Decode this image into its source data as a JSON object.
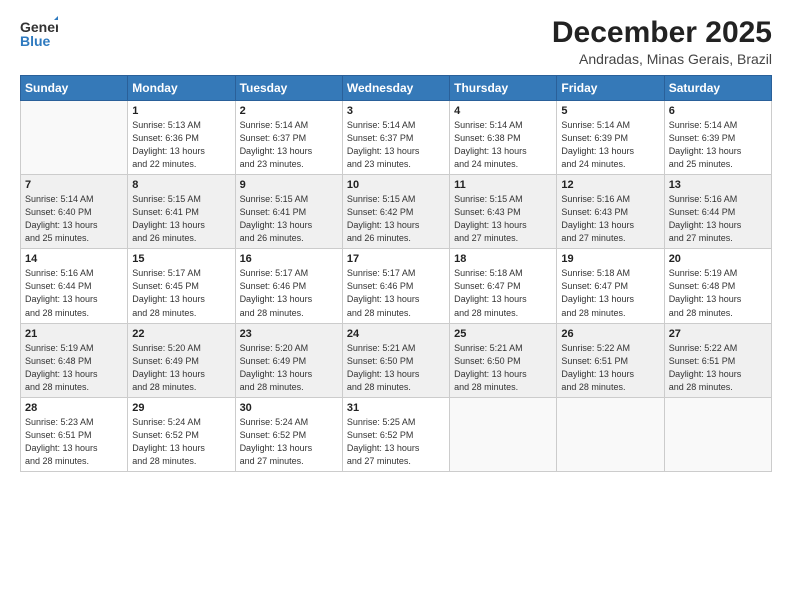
{
  "header": {
    "logo_general": "General",
    "logo_blue": "Blue",
    "month": "December 2025",
    "location": "Andradas, Minas Gerais, Brazil"
  },
  "days_of_week": [
    "Sunday",
    "Monday",
    "Tuesday",
    "Wednesday",
    "Thursday",
    "Friday",
    "Saturday"
  ],
  "weeks": [
    [
      {
        "day": "",
        "info": ""
      },
      {
        "day": "1",
        "info": "Sunrise: 5:13 AM\nSunset: 6:36 PM\nDaylight: 13 hours\nand 22 minutes."
      },
      {
        "day": "2",
        "info": "Sunrise: 5:14 AM\nSunset: 6:37 PM\nDaylight: 13 hours\nand 23 minutes."
      },
      {
        "day": "3",
        "info": "Sunrise: 5:14 AM\nSunset: 6:37 PM\nDaylight: 13 hours\nand 23 minutes."
      },
      {
        "day": "4",
        "info": "Sunrise: 5:14 AM\nSunset: 6:38 PM\nDaylight: 13 hours\nand 24 minutes."
      },
      {
        "day": "5",
        "info": "Sunrise: 5:14 AM\nSunset: 6:39 PM\nDaylight: 13 hours\nand 24 minutes."
      },
      {
        "day": "6",
        "info": "Sunrise: 5:14 AM\nSunset: 6:39 PM\nDaylight: 13 hours\nand 25 minutes."
      }
    ],
    [
      {
        "day": "7",
        "info": "Sunrise: 5:14 AM\nSunset: 6:40 PM\nDaylight: 13 hours\nand 25 minutes."
      },
      {
        "day": "8",
        "info": "Sunrise: 5:15 AM\nSunset: 6:41 PM\nDaylight: 13 hours\nand 26 minutes."
      },
      {
        "day": "9",
        "info": "Sunrise: 5:15 AM\nSunset: 6:41 PM\nDaylight: 13 hours\nand 26 minutes."
      },
      {
        "day": "10",
        "info": "Sunrise: 5:15 AM\nSunset: 6:42 PM\nDaylight: 13 hours\nand 26 minutes."
      },
      {
        "day": "11",
        "info": "Sunrise: 5:15 AM\nSunset: 6:43 PM\nDaylight: 13 hours\nand 27 minutes."
      },
      {
        "day": "12",
        "info": "Sunrise: 5:16 AM\nSunset: 6:43 PM\nDaylight: 13 hours\nand 27 minutes."
      },
      {
        "day": "13",
        "info": "Sunrise: 5:16 AM\nSunset: 6:44 PM\nDaylight: 13 hours\nand 27 minutes."
      }
    ],
    [
      {
        "day": "14",
        "info": "Sunrise: 5:16 AM\nSunset: 6:44 PM\nDaylight: 13 hours\nand 28 minutes."
      },
      {
        "day": "15",
        "info": "Sunrise: 5:17 AM\nSunset: 6:45 PM\nDaylight: 13 hours\nand 28 minutes."
      },
      {
        "day": "16",
        "info": "Sunrise: 5:17 AM\nSunset: 6:46 PM\nDaylight: 13 hours\nand 28 minutes."
      },
      {
        "day": "17",
        "info": "Sunrise: 5:17 AM\nSunset: 6:46 PM\nDaylight: 13 hours\nand 28 minutes."
      },
      {
        "day": "18",
        "info": "Sunrise: 5:18 AM\nSunset: 6:47 PM\nDaylight: 13 hours\nand 28 minutes."
      },
      {
        "day": "19",
        "info": "Sunrise: 5:18 AM\nSunset: 6:47 PM\nDaylight: 13 hours\nand 28 minutes."
      },
      {
        "day": "20",
        "info": "Sunrise: 5:19 AM\nSunset: 6:48 PM\nDaylight: 13 hours\nand 28 minutes."
      }
    ],
    [
      {
        "day": "21",
        "info": "Sunrise: 5:19 AM\nSunset: 6:48 PM\nDaylight: 13 hours\nand 28 minutes."
      },
      {
        "day": "22",
        "info": "Sunrise: 5:20 AM\nSunset: 6:49 PM\nDaylight: 13 hours\nand 28 minutes."
      },
      {
        "day": "23",
        "info": "Sunrise: 5:20 AM\nSunset: 6:49 PM\nDaylight: 13 hours\nand 28 minutes."
      },
      {
        "day": "24",
        "info": "Sunrise: 5:21 AM\nSunset: 6:50 PM\nDaylight: 13 hours\nand 28 minutes."
      },
      {
        "day": "25",
        "info": "Sunrise: 5:21 AM\nSunset: 6:50 PM\nDaylight: 13 hours\nand 28 minutes."
      },
      {
        "day": "26",
        "info": "Sunrise: 5:22 AM\nSunset: 6:51 PM\nDaylight: 13 hours\nand 28 minutes."
      },
      {
        "day": "27",
        "info": "Sunrise: 5:22 AM\nSunset: 6:51 PM\nDaylight: 13 hours\nand 28 minutes."
      }
    ],
    [
      {
        "day": "28",
        "info": "Sunrise: 5:23 AM\nSunset: 6:51 PM\nDaylight: 13 hours\nand 28 minutes."
      },
      {
        "day": "29",
        "info": "Sunrise: 5:24 AM\nSunset: 6:52 PM\nDaylight: 13 hours\nand 28 minutes."
      },
      {
        "day": "30",
        "info": "Sunrise: 5:24 AM\nSunset: 6:52 PM\nDaylight: 13 hours\nand 27 minutes."
      },
      {
        "day": "31",
        "info": "Sunrise: 5:25 AM\nSunset: 6:52 PM\nDaylight: 13 hours\nand 27 minutes."
      },
      {
        "day": "",
        "info": ""
      },
      {
        "day": "",
        "info": ""
      },
      {
        "day": "",
        "info": ""
      }
    ]
  ]
}
